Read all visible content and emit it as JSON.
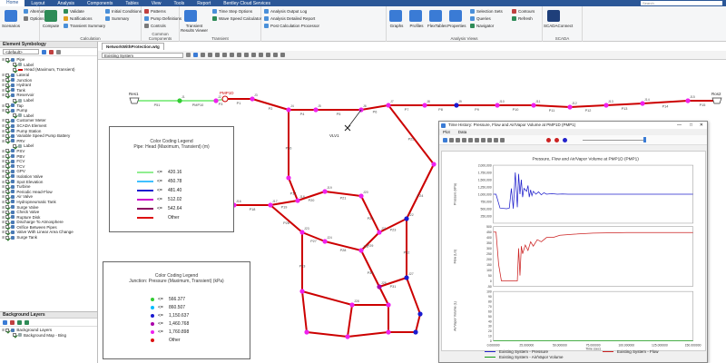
{
  "menubar": {
    "tabs": [
      "Home",
      "Layout",
      "Analysis",
      "Components",
      "Tables",
      "View",
      "Tools",
      "Report",
      "Bentley Cloud Services"
    ],
    "active_index": 0,
    "search_placeholder": "Search"
  },
  "ribbon": {
    "groups": [
      {
        "id": "scenarios",
        "label": "",
        "big": {
          "label": "Scenarios",
          "color": "#3a7bd5"
        },
        "items": [
          {
            "label": "Alternatives",
            "color": "#4a90d9"
          },
          {
            "label": "Options",
            "color": "#7a7a7a"
          }
        ]
      },
      {
        "id": "calculation",
        "label": "Calculation",
        "big": {
          "label": "Compute",
          "color": "#2e8b57"
        },
        "items": [
          {
            "label": "Validate",
            "color": "#2e8b57"
          },
          {
            "label": "Notifications",
            "color": "#e0a020"
          },
          {
            "label": "Transient Summary",
            "color": "#4a90d9"
          },
          {
            "label": "Initial Conditions",
            "color": "#4a90d9"
          },
          {
            "label": "Summary",
            "color": "#4a90d9"
          }
        ]
      },
      {
        "id": "common",
        "label": "Common Components",
        "items": [
          {
            "label": "Patterns",
            "color": "#c04040"
          },
          {
            "label": "Pump Definitions",
            "color": "#4a90d9"
          },
          {
            "label": "Controls",
            "color": "#7a7a7a"
          }
        ]
      },
      {
        "id": "transient",
        "label": "Transient",
        "big": {
          "label": "Transient Results Viewer",
          "color": "#3a7bd5"
        },
        "items": [
          {
            "label": "Time Step Options",
            "color": "#4a90d9"
          },
          {
            "label": "Wave Speed Calculator",
            "color": "#2e8b57"
          }
        ]
      },
      {
        "id": "analysis",
        "label": "",
        "items": [
          {
            "label": "Analysis Output Log",
            "color": "#4a90d9"
          },
          {
            "label": "Analysis Detailed Report",
            "color": "#4a90d9"
          },
          {
            "label": "Post Calculation Processor",
            "color": "#4a90d9"
          }
        ]
      },
      {
        "id": "analysisviews",
        "label": "Analysis Views",
        "bigs": [
          {
            "label": "Graphs",
            "color": "#3a7bd5"
          },
          {
            "label": "Profiles",
            "color": "#3a7bd5"
          },
          {
            "label": "FlexTables",
            "color": "#3a7bd5"
          },
          {
            "label": "Properties",
            "color": "#3a7bd5"
          }
        ],
        "items": [
          {
            "label": "Selection Sets",
            "color": "#4a90d9"
          },
          {
            "label": "Queries",
            "color": "#4a90d9"
          },
          {
            "label": "Navigator",
            "color": "#2e8b57"
          },
          {
            "label": "Contours",
            "color": "#c04040"
          },
          {
            "label": "Refresh",
            "color": "#2e8b57"
          }
        ]
      },
      {
        "id": "scada",
        "label": "SCADA",
        "big": {
          "label": "SCADAConnect",
          "color": "#1f3f7a"
        },
        "items": []
      }
    ]
  },
  "element_symbology": {
    "title": "Element Symbology",
    "dropdown": "<default>",
    "rows": [
      {
        "indent": 0,
        "label": "Pipe",
        "checked": true
      },
      {
        "indent": 1,
        "label": "Label",
        "checked": true
      },
      {
        "indent": 1,
        "label": "Head (Maximum, Transient)",
        "checked": true,
        "swatch": "#cc0000"
      },
      {
        "indent": 0,
        "label": "Lateral",
        "checked": true
      },
      {
        "indent": 0,
        "label": "Junction",
        "checked": true
      },
      {
        "indent": 0,
        "label": "Hydrant",
        "checked": true
      },
      {
        "indent": 0,
        "label": "Tank",
        "checked": true
      },
      {
        "indent": 0,
        "label": "Reservoir",
        "checked": true
      },
      {
        "indent": 1,
        "label": "Label",
        "checked": true
      },
      {
        "indent": 0,
        "label": "Tap",
        "checked": true
      },
      {
        "indent": 0,
        "label": "Pump",
        "checked": true
      },
      {
        "indent": 1,
        "label": "Label",
        "checked": true
      },
      {
        "indent": 0,
        "label": "Customer Meter",
        "checked": true
      },
      {
        "indent": 0,
        "label": "SCADA Element",
        "checked": true
      },
      {
        "indent": 0,
        "label": "Pump Station",
        "checked": true
      },
      {
        "indent": 0,
        "label": "Variable Speed Pump Battery",
        "checked": true
      },
      {
        "indent": 0,
        "label": "PRV",
        "checked": true
      },
      {
        "indent": 1,
        "label": "Label",
        "checked": true
      },
      {
        "indent": 0,
        "label": "PSV",
        "checked": true
      },
      {
        "indent": 0,
        "label": "PBV",
        "checked": true
      },
      {
        "indent": 0,
        "label": "FCV",
        "checked": true
      },
      {
        "indent": 0,
        "label": "TCV",
        "checked": true
      },
      {
        "indent": 0,
        "label": "GPV",
        "checked": true
      },
      {
        "indent": 0,
        "label": "Isolation Valve",
        "checked": true
      },
      {
        "indent": 0,
        "label": "Spot Elevation",
        "checked": true
      },
      {
        "indent": 0,
        "label": "Turbine",
        "checked": true
      },
      {
        "indent": 0,
        "label": "Periodic Head-Flow",
        "checked": true
      },
      {
        "indent": 0,
        "label": "Air Valve",
        "checked": true
      },
      {
        "indent": 0,
        "label": "Hydropneumatic Tank",
        "checked": true
      },
      {
        "indent": 0,
        "label": "Surge Valve",
        "checked": true
      },
      {
        "indent": 0,
        "label": "Check Valve",
        "checked": true
      },
      {
        "indent": 0,
        "label": "Rupture Disk",
        "checked": true
      },
      {
        "indent": 0,
        "label": "Discharge To Atmosphere",
        "checked": true
      },
      {
        "indent": 0,
        "label": "Orifice Between Pipes",
        "checked": true
      },
      {
        "indent": 0,
        "label": "Valve With Linear Area Change",
        "checked": true
      },
      {
        "indent": 0,
        "label": "Surge Tank",
        "checked": true
      }
    ]
  },
  "background_layers": {
    "title": "Background Layers",
    "rows": [
      {
        "indent": 0,
        "label": "Background Layers",
        "checked": true
      },
      {
        "indent": 1,
        "label": "Background Map - Bing",
        "checked": true
      }
    ]
  },
  "document": {
    "tab": "NetworkWithProtection.wtg",
    "scenario": "Existing System"
  },
  "pipe_legend": {
    "title": "Color Coding Legend",
    "subtitle": "Pipe: Head (Maximum, Transient) (m)",
    "rows": [
      {
        "op": "<=",
        "value": "420.16",
        "color": "#90ee90"
      },
      {
        "op": "<=",
        "value": "450.78",
        "color": "#40c0ff"
      },
      {
        "op": "<=",
        "value": "481.40",
        "color": "#1a1ad0"
      },
      {
        "op": "<=",
        "value": "512.02",
        "color": "#cc00cc"
      },
      {
        "op": "<=",
        "value": "542.64",
        "color": "#8a0060"
      },
      {
        "op": "",
        "value": "Other",
        "color": "#dd1111"
      }
    ]
  },
  "junction_legend": {
    "title": "Color Coding Legend",
    "subtitle": "Junction: Pressure (Maximum, Transient) (kPa)",
    "rows": [
      {
        "op": "<=",
        "value": "566.377",
        "color": "#33cc33"
      },
      {
        "op": "<=",
        "value": "860.507",
        "color": "#00bbff"
      },
      {
        "op": "<=",
        "value": "1,150.637",
        "color": "#1a1ad0"
      },
      {
        "op": "<=",
        "value": "1,460.768",
        "color": "#aa00aa"
      },
      {
        "op": "<=",
        "value": "1,760.898",
        "color": "#ee22ee"
      },
      {
        "op": "",
        "value": "Other",
        "color": "#dd1111"
      }
    ]
  },
  "network_labels": {
    "reservoir_left": "Res1",
    "reservoir_right": "Ros2",
    "pump": "PMP1D",
    "valve": "VLV1",
    "pipes": [
      "P51",
      "PMP10",
      "P3",
      "P1",
      "P2",
      "P4",
      "P5",
      "P6",
      "P7",
      "P8",
      "P9",
      "P10",
      "P11",
      "P12",
      "P13",
      "P14",
      "P15",
      "P16",
      "P17",
      "P18",
      "P19",
      "P20",
      "P21",
      "P22",
      "P23",
      "P24",
      "P25",
      "P26",
      "P27",
      "P28",
      "P29",
      "P30",
      "P31",
      "P32",
      "P33"
    ],
    "junctions": [
      "J1",
      "J2",
      "J3",
      "J4",
      "J5",
      "J6",
      "J7",
      "J8",
      "J9",
      "J10",
      "J11",
      "J12",
      "J13",
      "J14",
      "J15",
      "J16",
      "J17",
      "J18",
      "J19",
      "J20",
      "J21",
      "J22",
      "J23",
      "J24",
      "J25",
      "J26",
      "J27",
      "J28"
    ]
  },
  "chart_window": {
    "title": "Time History: Pressure, Flow and Air/Vapor Volume at PMP1D (PMP1)",
    "menu": [
      "Plot",
      "Data"
    ],
    "controls": [
      "—",
      "□",
      "✕"
    ]
  },
  "chart_data": {
    "type": "line",
    "title": "Pressure, Flow and Air/Vapor Volume at PMP1D (PMP1)",
    "xlabel": "Time (sec)",
    "xlim": [
      0,
      150
    ],
    "xticks": [
      "0.000000",
      "25.000000",
      "50.000000",
      "75.000000",
      "100.000000",
      "125.000000",
      "150.000000"
    ],
    "panels": [
      {
        "ylabel": "Pressure (kPa)",
        "ylim": [
          0,
          2000000
        ],
        "yticks": [
          "2,000,000",
          "1,750,000",
          "1,500,000",
          "1,250,000",
          "1,000,000",
          "750,000",
          "500,000",
          "250,000"
        ],
        "series": [
          {
            "name": "Existing System - Pressure",
            "color": "#2222cc",
            "x": [
              0,
              2,
              5,
              10,
              12,
              13.5,
              15,
              16.5,
              18,
              19,
              20,
              21,
              22,
              23,
              25,
              26,
              27,
              28,
              29,
              30,
              32,
              34,
              36,
              38,
              40,
              44,
              48,
              52,
              56,
              60,
              70,
              80,
              100,
              125,
              150
            ],
            "y": [
              1000000,
              1000000,
              520000,
              500000,
              520000,
              1200000,
              500000,
              1750000,
              550000,
              1700000,
              1000000,
              1500000,
              900000,
              1200000,
              1100000,
              1300000,
              900000,
              1150000,
              950000,
              1100000,
              1000000,
              1080000,
              980000,
              1050000,
              1000000,
              1020000,
              1000000,
              1010000,
              1000000,
              1000000,
              1000000,
              1000000,
              1000000,
              1000000,
              1000000
            ]
          }
        ]
      },
      {
        "ylabel": "Flow (L/s)",
        "ylim": [
          -50,
          500
        ],
        "yticks": [
          "500",
          "450",
          "400",
          "350",
          "300",
          "250",
          "200",
          "150",
          "100",
          "50",
          "0",
          "-50"
        ],
        "series": [
          {
            "name": "Existing System - Flow",
            "color": "#cc2222",
            "x": [
              0,
              2,
              4,
              6,
              10,
              18,
              19,
              20,
              21,
              22,
              24,
              26,
              28,
              30,
              33,
              36,
              40,
              45,
              50,
              60,
              75,
              100,
              125,
              150
            ],
            "y": [
              450,
              450,
              150,
              0,
              0,
              0,
              300,
              50,
              320,
              250,
              330,
              280,
              360,
              320,
              380,
              360,
              400,
              400,
              420,
              430,
              440,
              445,
              445,
              445
            ]
          }
        ]
      },
      {
        "ylabel": "Air/Vapor Volume (L)",
        "ylim": [
          0,
          100
        ],
        "yticks": [
          "100",
          "90",
          "80",
          "70",
          "60",
          "50",
          "40",
          "30",
          "20",
          "10",
          "0"
        ],
        "series": [
          {
            "name": "Existing System - Air/Vapor Volume",
            "color": "#119911",
            "x": [
              0,
              150
            ],
            "y": [
              0,
              0
            ]
          }
        ]
      }
    ],
    "legend": [
      "Existing System - Pressure",
      "Existing System - Flow",
      "Existing System - Air/Vapor Volume"
    ],
    "legend_placement": "bottom"
  }
}
